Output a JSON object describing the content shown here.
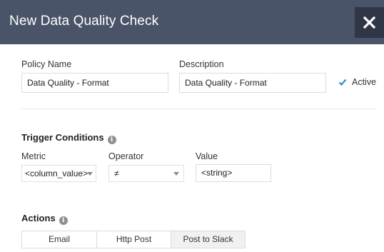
{
  "dialog": {
    "title": "New Data Quality Check",
    "close_icon": "close-icon"
  },
  "policy": {
    "name_label": "Policy Name",
    "name_value": "Data Quality - Format",
    "description_label": "Description",
    "description_value": "Data Quality - Format",
    "active_label": "Active",
    "active_checked": true
  },
  "trigger": {
    "title": "Trigger Conditions",
    "metric_label": "Metric",
    "metric_value": "<column_value>",
    "operator_label": "Operator",
    "operator_value": "≠",
    "value_label": "Value",
    "value_value": "<string>"
  },
  "actions": {
    "title": "Actions",
    "tabs": [
      {
        "label": "Email",
        "active": false
      },
      {
        "label": "Http Post",
        "active": false
      },
      {
        "label": "Post to Slack",
        "active": true
      }
    ]
  },
  "colors": {
    "titlebar": "#4a5468",
    "close_button": "#2f3645",
    "checkmark": "#2a8fd8"
  }
}
